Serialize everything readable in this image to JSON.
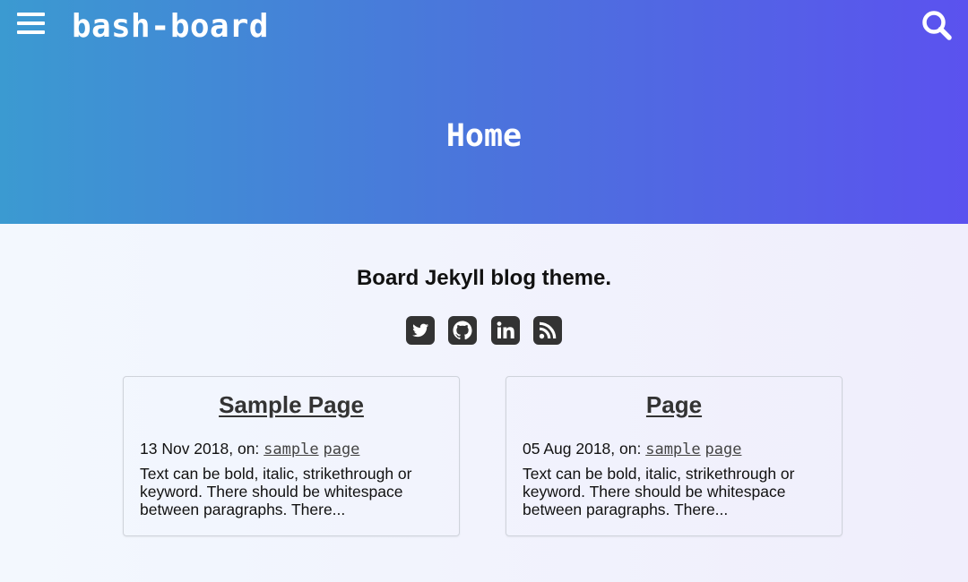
{
  "header": {
    "site_title": "bash-board",
    "menu_icon": "hamburger-menu-icon",
    "search_icon": "search-icon",
    "page_title": "Home",
    "gradient_start": "#3b9ad1",
    "gradient_end": "#5b52ef"
  },
  "intro": {
    "tagline": "Board Jekyll blog theme."
  },
  "social": [
    {
      "name": "twitter",
      "icon": "twitter-icon"
    },
    {
      "name": "github",
      "icon": "github-icon"
    },
    {
      "name": "linkedin",
      "icon": "linkedin-icon"
    },
    {
      "name": "rss",
      "icon": "rss-icon"
    }
  ],
  "posts": [
    {
      "title": "Sample Page",
      "date": "13 Nov 2018, on:",
      "tags": [
        "sample",
        "page"
      ],
      "excerpt": "Text can be bold, italic, strikethrough or keyword. There should be whitespace between paragraphs. There..."
    },
    {
      "title": "Page",
      "date": "05 Aug 2018, on:",
      "tags": [
        "sample",
        "page"
      ],
      "excerpt": "Text can be bold, italic, strikethrough or keyword. There should be whitespace between paragraphs. There..."
    }
  ]
}
